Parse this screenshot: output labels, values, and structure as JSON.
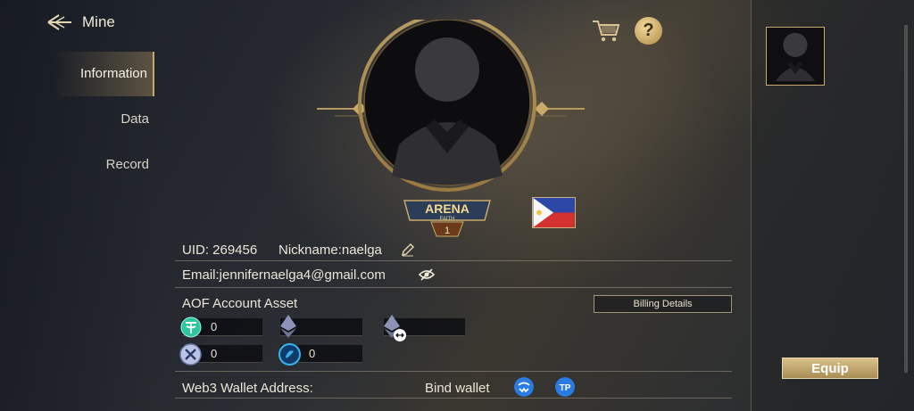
{
  "header": {
    "back_label": "Mine"
  },
  "sidebar": {
    "tabs": [
      {
        "label": "Information",
        "active": true
      },
      {
        "label": "Data"
      },
      {
        "label": "Record"
      }
    ]
  },
  "profile": {
    "uid_label": "UID: 269456",
    "nickname_label": "Nickname:naelga",
    "email_label": "Email:jennifernaelga4@gmail.com",
    "rank_emblem": {
      "title": "ARENA",
      "subtitle": "FAITH",
      "level": "1"
    },
    "flag": "philippines-flag"
  },
  "assets": {
    "title": "AOF Account Asset",
    "billing_button": "Billing Details",
    "items": [
      {
        "icon": "tether-icon",
        "value": "0"
      },
      {
        "icon": "ethereum-icon",
        "value": ""
      },
      {
        "icon": "ethereum-link-icon",
        "value": ""
      },
      {
        "icon": "x-token-icon",
        "value": "0"
      },
      {
        "icon": "blue-token-icon",
        "value": "0"
      }
    ]
  },
  "wallet": {
    "label": "Web3 Wallet Address:",
    "bind_label": "Bind wallet"
  },
  "right_panel": {
    "equip_label": "Equip"
  },
  "colors": {
    "gold": "#c9aa6a",
    "teal": "#2bc7a0",
    "blue": "#2a7be4"
  }
}
